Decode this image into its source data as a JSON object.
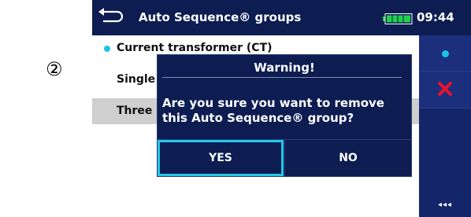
{
  "step_marker": "②",
  "header": {
    "title": "Auto Sequence® groups",
    "time": "09:44"
  },
  "list": {
    "items": [
      {
        "label": "Current transformer (CT)",
        "has_dot": true
      },
      {
        "label": "Single"
      },
      {
        "label": "Three"
      }
    ]
  },
  "dialog": {
    "title": "Warning!",
    "message_line1": "Are you sure you want to remove",
    "message_line2": "this Auto Sequence® group?",
    "yes_label": "YES",
    "no_label": "NO"
  },
  "sidebar": {
    "more_label": "◂◂◂"
  },
  "colors": {
    "header_bg": "#0d1d52",
    "accent_cyan": "#21c9e8",
    "delete_red": "#e8122a",
    "selected_row": "#cfcfcf"
  },
  "icons": [
    "back-icon",
    "battery-icon",
    "dot-icon",
    "delete-icon",
    "more-icon"
  ]
}
